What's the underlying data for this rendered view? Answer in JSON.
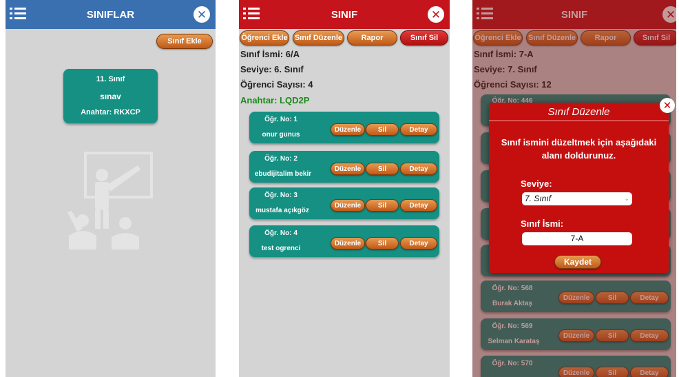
{
  "screen1": {
    "title": "SINIFLAR",
    "add_button": "Sınıf Ekle",
    "card": {
      "name": "11. Sınıf",
      "subtitle": "sınav",
      "key": "Anahtar: RKXCP"
    }
  },
  "screen2": {
    "title": "SINIF",
    "buttons": {
      "add_student": "Öğrenci Ekle",
      "edit_class": "Sınıf Düzenle",
      "report": "Rapor",
      "delete_class": "Sınıf Sil"
    },
    "info": {
      "class_name": "Sınıf İsmi: 6/A",
      "level": "Seviye: 6. Sınıf",
      "student_count": "Öğrenci Sayısı: 4",
      "key": "Anahtar: LQD2P"
    },
    "row_buttons": {
      "edit": "Düzenle",
      "delete": "Sil",
      "detail": "Detay"
    },
    "students": [
      {
        "no": "Öğr. No: 1",
        "name": "onur gunus"
      },
      {
        "no": "Öğr. No: 2",
        "name": "ebudijitalim bekir"
      },
      {
        "no": "Öğr. No: 3",
        "name": "mustafa açıkgöz"
      },
      {
        "no": "Öğr. No: 4",
        "name": "test ogrenci"
      }
    ]
  },
  "screen3": {
    "title": "SINIF",
    "buttons": {
      "add_student": "Öğrenci Ekle",
      "edit_class": "Sınıf Düzenle",
      "report": "Rapor",
      "delete_class": "Sınıf Sil"
    },
    "info": {
      "class_name": "Sınıf İsmi: 7-A",
      "level": "Seviye: 7. Sınıf",
      "student_count": "Öğrenci Sayısı: 12"
    },
    "row_buttons": {
      "edit": "Düzenle",
      "delete": "Sil",
      "detail": "Detay"
    },
    "students": [
      {
        "no": "Öğr. No: 446",
        "name": ""
      },
      {
        "no": "Öğr. No: 568",
        "name": "Burak Aktaş"
      },
      {
        "no": "Öğr. No: 569",
        "name": "Selman Karataş"
      },
      {
        "no": "Öğr. No: 570",
        "name": ""
      }
    ],
    "modal": {
      "title": "Sınıf Düzenle",
      "message": "Sınıf ismini düzeltmek için aşağıdaki alanı doldurunuz.",
      "level_label": "Seviye:",
      "level_value": "7. Sınıf",
      "name_label": "Sınıf İsmi:",
      "name_value": "7-A",
      "save_button": "Kaydet"
    }
  },
  "colors": {
    "blue_header": "#3a6fb0",
    "red_header": "#c5141c",
    "teal": "#159083",
    "orange_button": "#d6782f",
    "key_green": "#1a8a1a",
    "background": "#d4d4d4"
  }
}
